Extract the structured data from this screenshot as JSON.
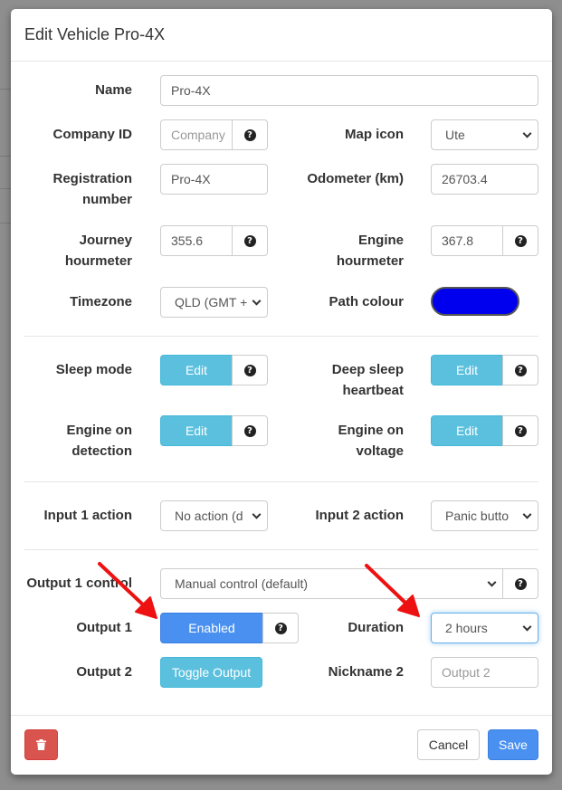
{
  "modal": {
    "title": "Edit Vehicle Pro-4X"
  },
  "fields": {
    "name": {
      "label": "Name",
      "value": "Pro-4X"
    },
    "company_id": {
      "label": "Company ID",
      "placeholder": "Company"
    },
    "map_icon": {
      "label": "Map icon",
      "value": "Ute"
    },
    "registration": {
      "label_1": "Registration",
      "label_2": "number",
      "value": "Pro-4X"
    },
    "odometer": {
      "label": "Odometer (km)",
      "value": "26703.4"
    },
    "journey_hourmeter": {
      "label_1": "Journey",
      "label_2": "hourmeter",
      "value": "355.6"
    },
    "engine_hourmeter": {
      "label_1": "Engine",
      "label_2": "hourmeter",
      "value": "367.8"
    },
    "timezone": {
      "label": "Timezone",
      "value": "QLD (GMT +"
    },
    "path_colour": {
      "label": "Path colour",
      "value": "#0000ee"
    },
    "sleep_mode": {
      "label": "Sleep mode",
      "button": "Edit"
    },
    "deep_sleep": {
      "label_1": "Deep sleep",
      "label_2": "heartbeat",
      "button": "Edit"
    },
    "engine_on_detection": {
      "label_1": "Engine on",
      "label_2": "detection",
      "button": "Edit"
    },
    "engine_on_voltage": {
      "label_1": "Engine on",
      "label_2": "voltage",
      "button": "Edit"
    },
    "input1": {
      "label": "Input 1 action",
      "value": "No action (d"
    },
    "input2": {
      "label": "Input 2 action",
      "value": "Panic butto"
    },
    "output1_control": {
      "label": "Output 1 control",
      "value": "Manual control (default)"
    },
    "output1": {
      "label": "Output 1",
      "button": "Enabled"
    },
    "duration": {
      "label": "Duration",
      "value": "2 hours"
    },
    "output2": {
      "label": "Output 2",
      "button": "Toggle Output"
    },
    "nickname2": {
      "label": "Nickname 2",
      "placeholder": "Output 2"
    }
  },
  "footer": {
    "cancel": "Cancel",
    "save": "Save"
  },
  "icons": {
    "help": "question-circle-icon",
    "delete": "trash-icon",
    "annotation": "red-arrow-icon"
  },
  "colors": {
    "accent_info": "#5bc0de",
    "primary": "#4a90f0",
    "danger": "#d9534f",
    "annotation": "#ee1111"
  }
}
